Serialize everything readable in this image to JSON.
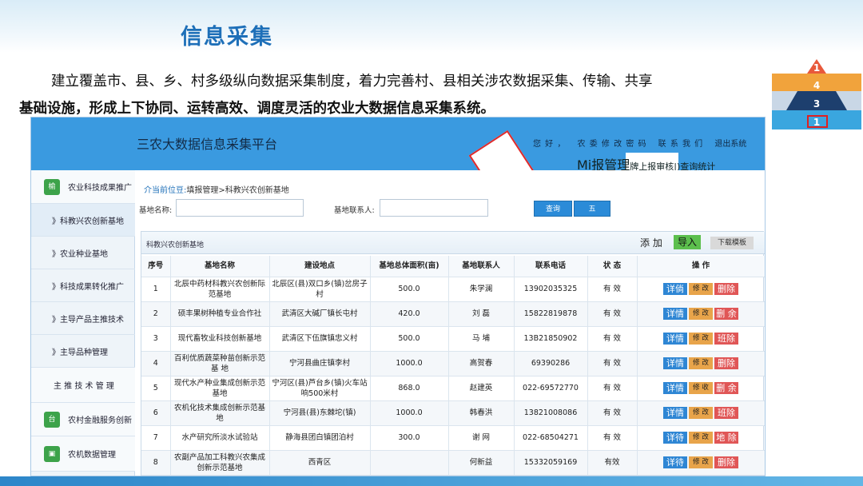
{
  "slide": {
    "title": "信息采集",
    "para_line1": "建立覆盖市、县、乡、村多级纵向数据采集制度，着力完善村、县相关涉农数据采集、传输、共享",
    "para_line2": "基础设施，形成上下协同、运转高效、调度灵活的农业大数据信息采集系统。"
  },
  "pyramid": {
    "labels": [
      "1",
      "4",
      "3",
      "1"
    ],
    "colors": [
      "#e8593b",
      "#f1a33c",
      "#1d3f6e",
      "#3aa6df"
    ],
    "highlighted": "1"
  },
  "app": {
    "title": "三农大数据信息采集平台",
    "top_links": [
      "您 好 ，",
      "农 委 修 改 密 码",
      "联 系 我 们",
      "退出系统"
    ],
    "report_big": "Mi报管理",
    "report_small": "牌上报审核|)查询统计",
    "sidebar": [
      {
        "label": "农业科技成果推广",
        "icon": "榆"
      },
      {
        "label": "》科教兴农创新基地"
      },
      {
        "label": "》农业种业基地"
      },
      {
        "label": "》科技成果转化推广"
      },
      {
        "label": "》主导产品主推技术"
      },
      {
        "label": "》主导品种管理"
      },
      {
        "label": "主 推 技 术 管 理"
      },
      {
        "label": "农村金融服务创新",
        "icon": "台"
      },
      {
        "label": "农机数据管理",
        "icon": "▣"
      }
    ],
    "breadcrumb_prefix": "介当前位豆:",
    "breadcrumb": "填报管理>科教兴农创新基地",
    "filters": {
      "name_label": "基地名称:",
      "contact_label": "基地联系人:",
      "name_value": "",
      "contact_value": "",
      "query_label": "查询",
      "second_label": "五"
    },
    "panel": {
      "title": "科教兴农创新基地",
      "add_label": "添 加",
      "import_label": "导入",
      "template_label": "下载模板"
    },
    "table": {
      "headers": [
        "序号",
        "基地名称",
        "建设地点",
        "基地总体面积(亩)",
        "基地联系人",
        "联系电话",
        "状 态",
        "操 作"
      ],
      "rows": [
        {
          "no": "1",
          "name": "北辰中药材科教兴农创新际范基地",
          "loc": "北辰区(县)双口乡(镇)岔房子 村",
          "area": "500.0",
          "contact": "朱学澜",
          "phone": "13902035325",
          "status": "有 效",
          "op1": "详倘",
          "op2": "修 改",
          "op3": "删除"
        },
        {
          "no": "2",
          "name": "硕丰果树种植专业合作社",
          "loc": "武清区大碱厂镇长屯村",
          "area": "420.0",
          "contact": "刘 磊",
          "phone": "15822819878",
          "status": "有 效",
          "op1": "详情",
          "op2": "修 改",
          "op3": "删 余"
        },
        {
          "no": "3",
          "name": "现代畜牧业科技创新基地",
          "loc": "武清区下伍旗镇忠义村",
          "area": "500.0",
          "contact": "马 埔",
          "phone": "13B21850902",
          "status": "有 效",
          "op1": "详情",
          "op2": "修 改",
          "op3": "班除"
        },
        {
          "no": "4",
          "name": "百利优质蔬菜种苗创新示范基 地",
          "loc": "宁河县曲庄镇李村",
          "area": "1000.0",
          "contact": "高贺春",
          "phone": "69390286",
          "status": "有 效",
          "op1": "详情",
          "op2": "修 改",
          "op3": "删除"
        },
        {
          "no": "5",
          "name": "现代水产种业集成创新示范基地",
          "loc": "宁河区(县)芦台乡(镇)火车站响500米村",
          "area": "868.0",
          "contact": "赵建英",
          "phone": "022-69572770",
          "status": "有 效",
          "op1": "详情",
          "op2": "修 收",
          "op3": "删 余"
        },
        {
          "no": "6",
          "name": "农机化技术集成创新示范基地",
          "loc": "宁河县(县)东棘坨(镇)",
          "area": "1000.0",
          "contact": "韩春洪",
          "phone": "13821008086",
          "status": "有 效",
          "op1": "详情",
          "op2": "修 改",
          "op3": "班除"
        },
        {
          "no": "7",
          "name": "水产研究所淡水试验站",
          "loc": "静海县团白镇团泊村",
          "area": "300.0",
          "contact": "谢 网",
          "phone": "022-68504271",
          "status": "有 效",
          "op1": "详待",
          "op2": "修 改",
          "op3": "地 除"
        },
        {
          "no": "8",
          "name": "农副产品加工科教兴农集成创新示范基地",
          "loc": "西青区",
          "area": "",
          "contact": "何新益",
          "phone": "15332059169",
          "status": "有效",
          "op1": "详待",
          "op2": "修 改",
          "op3": "删除"
        }
      ]
    }
  }
}
